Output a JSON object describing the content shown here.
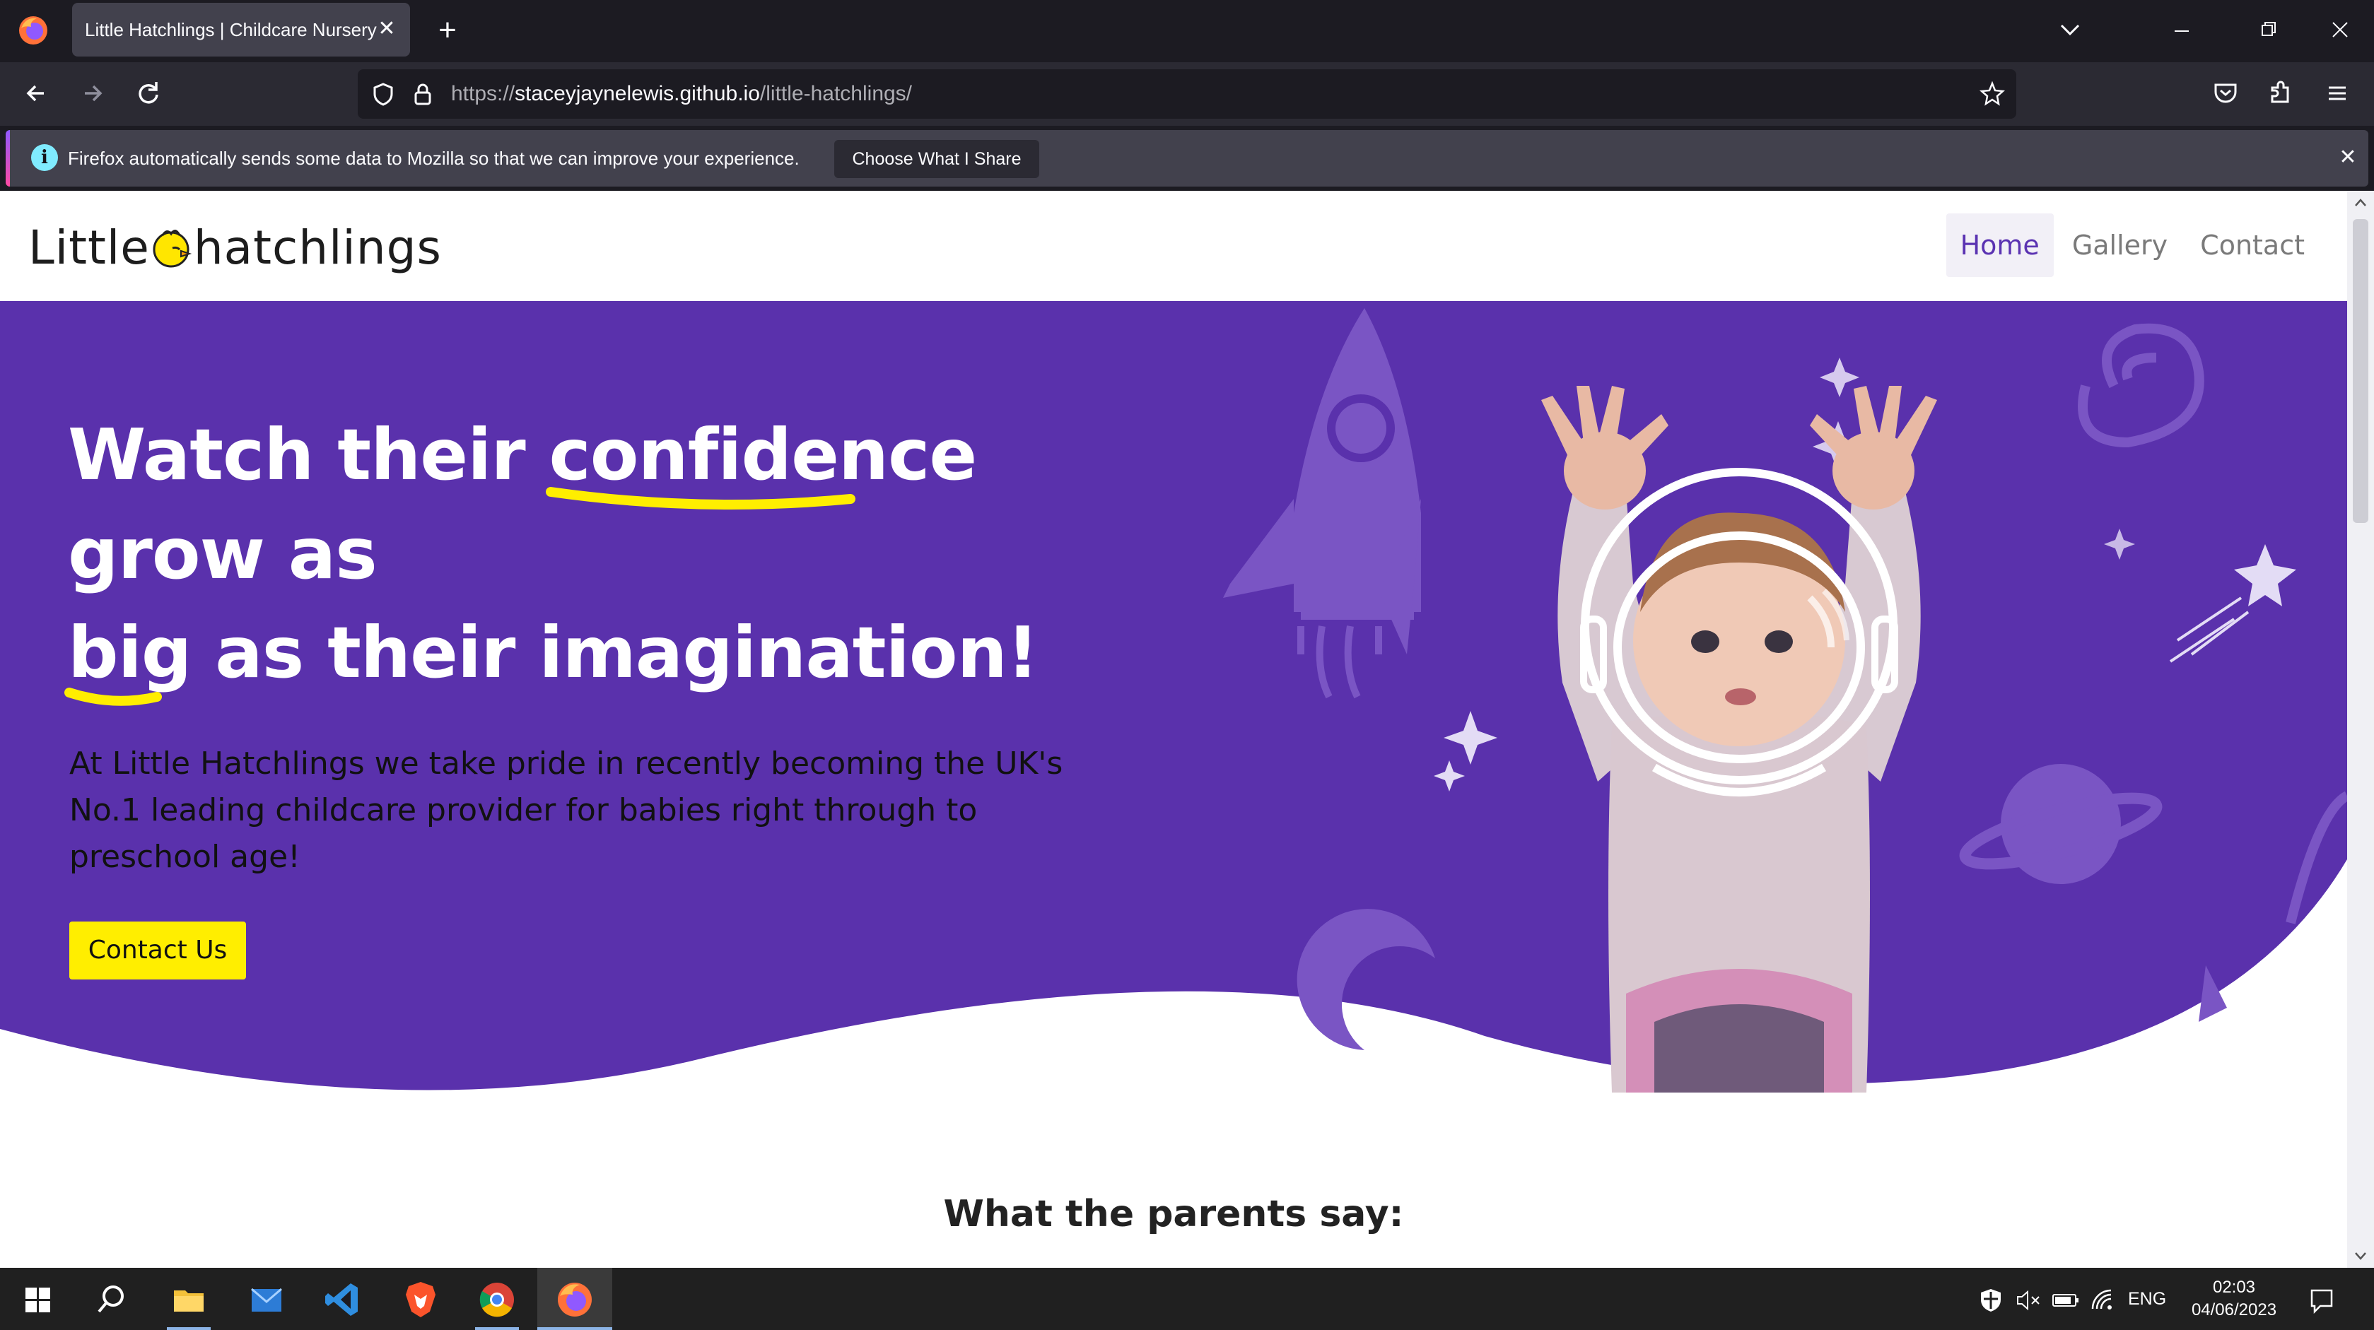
{
  "browser": {
    "tab_title": "Little Hatchlings | Childcare Nursery",
    "url_proto": "https://",
    "url_host": "staceyjaynelewis.github.io",
    "url_path": "/little-hatchlings/",
    "notification_text": "Firefox automatically sends some data to Mozilla so that we can improve your experience.",
    "notification_button": "Choose What I Share"
  },
  "site": {
    "logo_left": "Little",
    "logo_right": "hatchlings",
    "nav": [
      {
        "label": "Home",
        "active": true
      },
      {
        "label": "Gallery",
        "active": false
      },
      {
        "label": "Contact",
        "active": false
      }
    ],
    "hero": {
      "heading_1": "Watch their ",
      "heading_hl1": "confidence",
      "heading_2": " grow as",
      "heading_hl2": "big",
      "heading_3": " as their imagination!",
      "description": "At Little Hatchlings we take pride in recently becoming the UK's No.1 leading childcare provider for babies right through to preschool age!",
      "cta_label": "Contact Us"
    },
    "parents_heading": "What the parents say:"
  },
  "taskbar": {
    "language": "ENG",
    "time": "02:03",
    "date": "04/06/2023"
  },
  "colors": {
    "hero_purple": "#5a31ac",
    "accent_yellow": "#ffee00",
    "nav_active": "#5b33b2"
  }
}
